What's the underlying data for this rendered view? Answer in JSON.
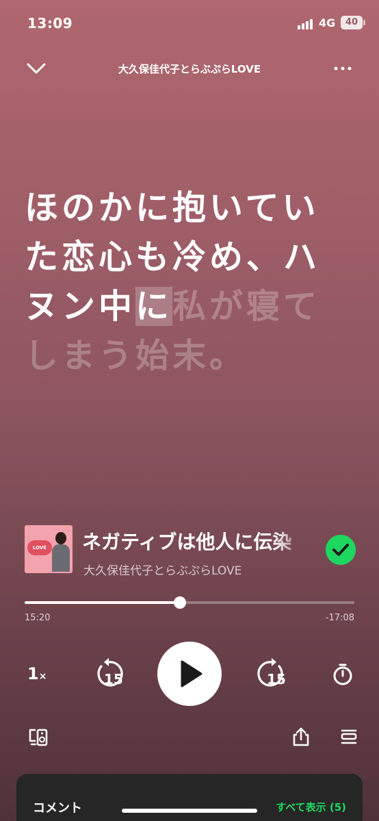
{
  "status_bar": {
    "time": "13:09",
    "network": "4G",
    "battery": "40"
  },
  "header": {
    "title": "大久保佳代子とらぶぷらLOVE"
  },
  "lyrics": {
    "lines": [
      {
        "active": "ほのかに抱いてい",
        "current": "",
        "upcoming": ""
      },
      {
        "active": "た恋心も冷め、ハ",
        "current": "",
        "upcoming": ""
      },
      {
        "active": "ヌン中",
        "current": "に",
        "upcoming": "私が寝て"
      },
      {
        "active": "",
        "current": "",
        "upcoming": "しまう始末。"
      }
    ]
  },
  "episode": {
    "title": "ネガティブは他人に伝染",
    "show": "大久保佳代子とらぶぷらLOVE",
    "artwork_text": "LOVE",
    "saved": true
  },
  "playback": {
    "progress": 0.47,
    "elapsed": "15:20",
    "remaining": "-17:08",
    "speed": "1",
    "speed_suffix": "×",
    "skip_back": "15",
    "skip_forward": "15"
  },
  "comments": {
    "title": "コメント",
    "show_all": "すべて表示 (5)"
  },
  "colors": {
    "accent": "#1ed760",
    "card": "#262626"
  },
  "icons": [
    "chevron-down-icon",
    "more-icon",
    "check-icon",
    "skip-back-icon",
    "play-icon",
    "skip-forward-icon",
    "timer-icon",
    "device-icon",
    "share-icon",
    "queue-icon"
  ]
}
